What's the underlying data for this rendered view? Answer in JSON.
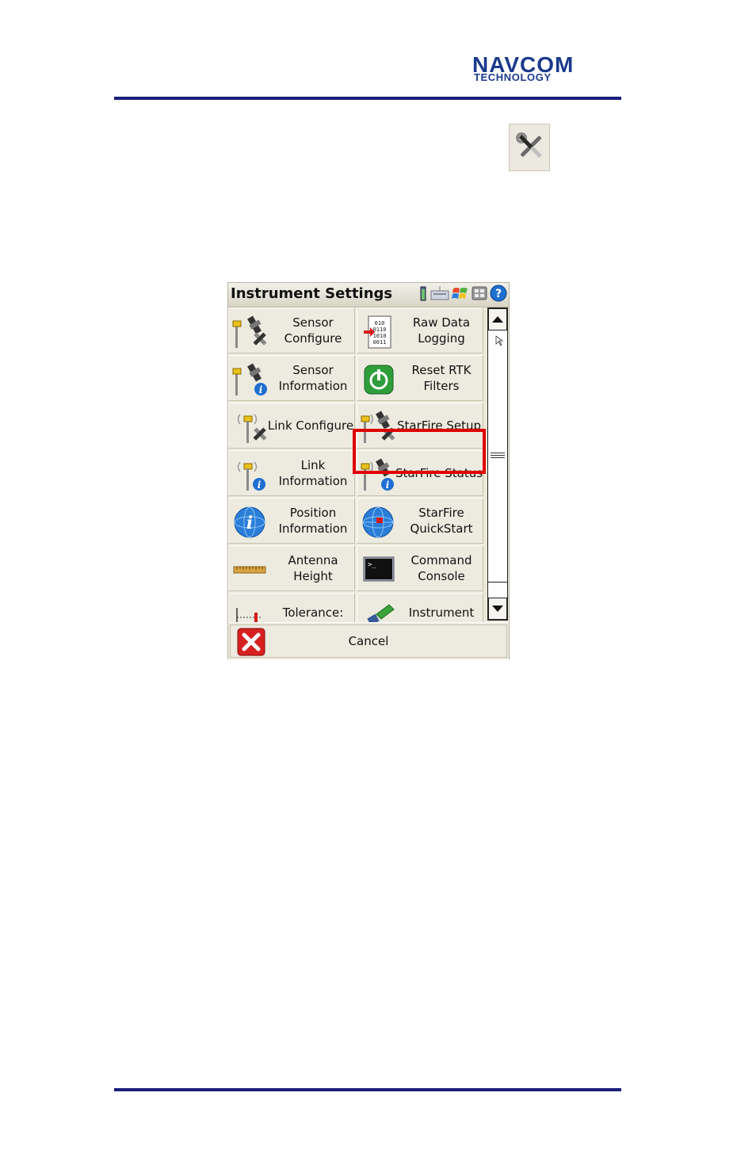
{
  "header": {
    "logo_top": "NAVCOM",
    "logo_bottom": "TECHNOLOGY"
  },
  "window": {
    "title": "Instrument Settings",
    "tray_icons": [
      "battery-icon",
      "keyboard-icon",
      "windows-start-icon",
      "network-icon",
      "help-icon"
    ]
  },
  "menu": {
    "items": [
      {
        "label": "Sensor\nConfigure",
        "icon": "sensor-configure-icon"
      },
      {
        "label": "Raw Data\nLogging",
        "icon": "raw-data-icon"
      },
      {
        "label": "Sensor\nInformation",
        "icon": "sensor-info-icon"
      },
      {
        "label": "Reset RTK\nFilters",
        "icon": "power-icon"
      },
      {
        "label": "Link Configure",
        "icon": "link-configure-icon"
      },
      {
        "label": "StarFire Setup",
        "icon": "starfire-setup-icon"
      },
      {
        "label": "Link\nInformation",
        "icon": "link-info-icon"
      },
      {
        "label": "StarFire Status",
        "icon": "starfire-status-icon"
      },
      {
        "label": "Position\nInformation",
        "icon": "info-globe-icon"
      },
      {
        "label": "StarFire\nQuickStart",
        "icon": "globe-icon"
      },
      {
        "label": "Antenna\nHeight",
        "icon": "ruler-icon"
      },
      {
        "label": "Command\nConsole",
        "icon": "terminal-icon"
      },
      {
        "label": "Tolerance:",
        "icon": "tolerance-icon"
      },
      {
        "label": "Instrument",
        "icon": "instrument-icon"
      }
    ],
    "highlighted": "StarFire Setup"
  },
  "cancel": {
    "label": "Cancel"
  },
  "colors": {
    "rule": "#1b1f7a",
    "logo": "#1a3a8c",
    "highlight": "#e00000"
  }
}
